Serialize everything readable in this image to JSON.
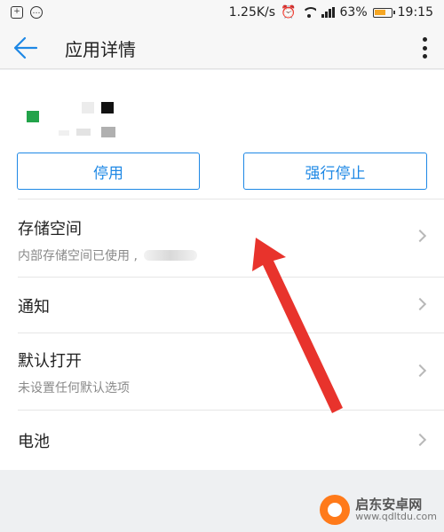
{
  "status_bar": {
    "network_speed": "1.25K/s",
    "battery_percent": "63%",
    "time": "19:15",
    "left_icons": [
      "sim-card-icon",
      "message-icon"
    ],
    "right_icons": [
      "alarm-icon",
      "wifi-icon",
      "signal-icon",
      "battery-icon"
    ]
  },
  "header": {
    "back_icon": "back-arrow-icon",
    "title": "应用详情",
    "menu_icon": "more-vert-icon"
  },
  "actions": {
    "disable_label": "停用",
    "force_stop_label": "强行停止"
  },
  "settings": [
    {
      "label": "存储空间",
      "sub": "内部存储空间已使用 ,"
    },
    {
      "label": "通知",
      "sub": ""
    },
    {
      "label": "默认打开",
      "sub": "未设置任何默认选项"
    },
    {
      "label": "电池",
      "sub": ""
    }
  ],
  "watermark": {
    "main": "启东安卓网",
    "sub": "www.qdltdu.com"
  },
  "colors": {
    "accent": "#1e88e5",
    "annotation_arrow": "#e8332c"
  }
}
